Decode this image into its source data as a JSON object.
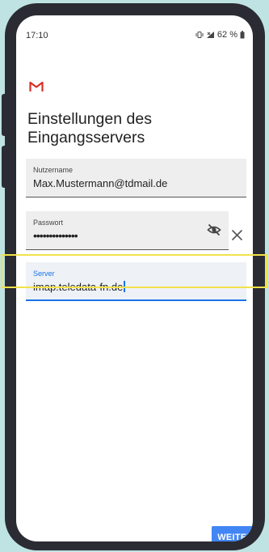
{
  "status_bar": {
    "time": "17:10",
    "battery": "62 %"
  },
  "app": {
    "logo": "gmail-logo"
  },
  "title": "Einstellungen des Eingangsservers",
  "fields": {
    "username": {
      "label": "Nutzername",
      "value": "Max.Mustermann@tdmail.de"
    },
    "password": {
      "label": "Passwort",
      "value": "••••••••••••••"
    },
    "server": {
      "label": "Server",
      "value": "imap.teledata-fn.de"
    }
  },
  "actions": {
    "next_label": "WEITER"
  },
  "colors": {
    "accent": "#1a73e8",
    "button": "#4285f4",
    "highlight": "#f2e24a",
    "gmail_red": "#d93025"
  }
}
